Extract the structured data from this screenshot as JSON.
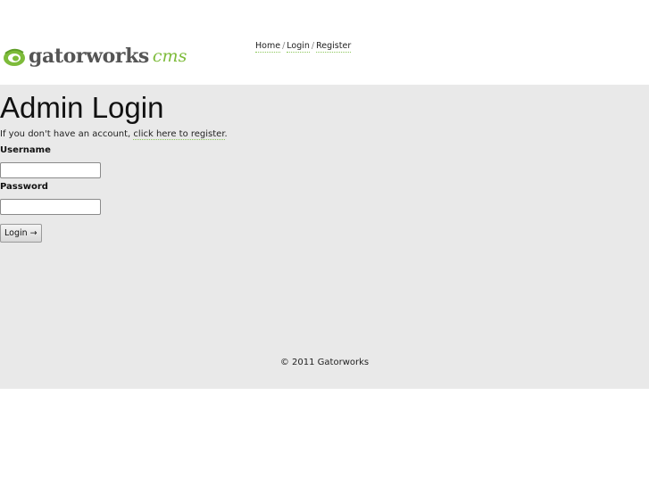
{
  "brand": {
    "name": "gatorworks",
    "suffix": "cms",
    "logo_icon": "gatorworks-swoosh-logo",
    "accent_color": "#7dbb3a"
  },
  "nav": {
    "home": "Home",
    "login": "Login",
    "register": "Register",
    "separator": "/"
  },
  "main": {
    "title": "Admin Login",
    "intro_prefix": "If you don't have an account,",
    "intro_link": "click here to register",
    "intro_suffix": ".",
    "username_label": "Username",
    "username_value": "",
    "password_label": "Password",
    "password_value": "",
    "login_button_label": "Login",
    "login_button_icon": "arrow-right-icon",
    "login_button_arrow": "→"
  },
  "footer": {
    "copyright": "© 2011 Gatorworks"
  },
  "colors": {
    "panel_background": "#e9e9e9",
    "link_underline": "#8cc65a"
  }
}
